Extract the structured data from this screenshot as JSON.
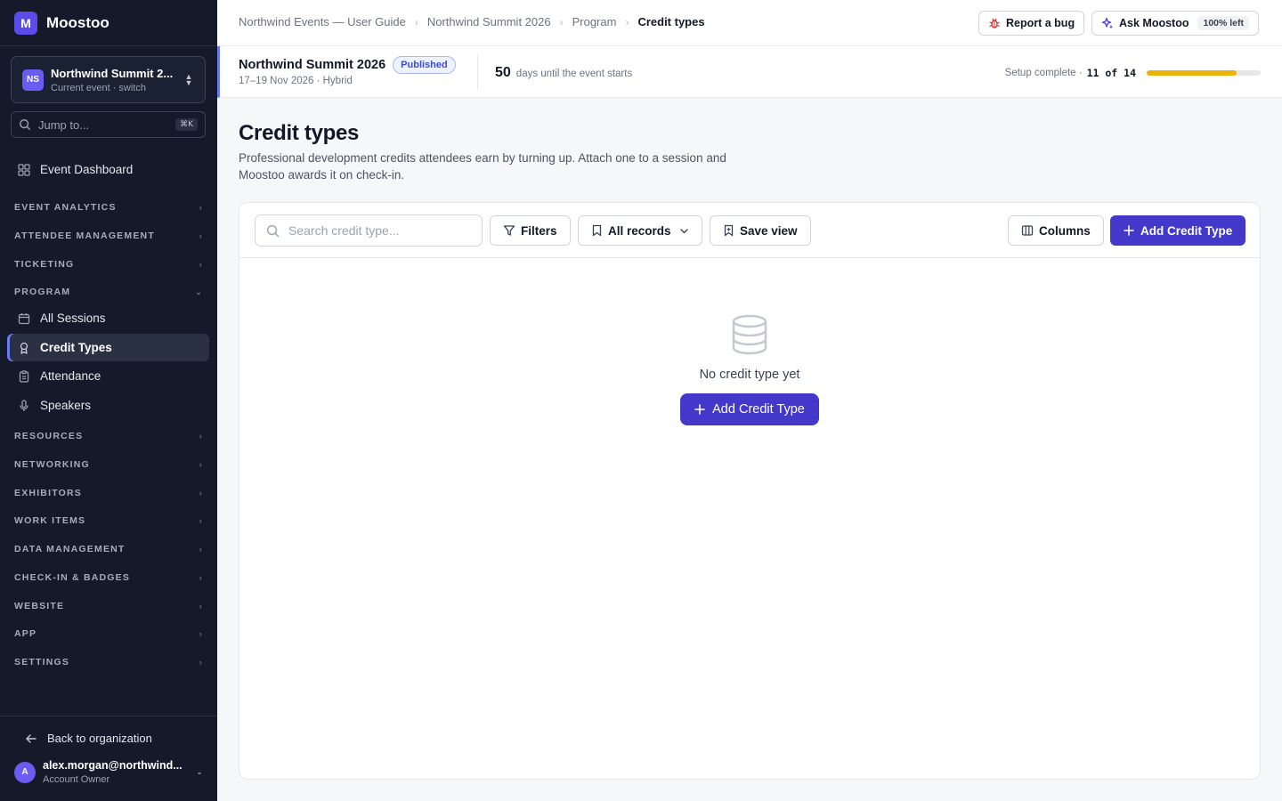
{
  "brand": {
    "logo_letter": "M",
    "name": "Moostoo"
  },
  "event_switcher": {
    "initials": "NS",
    "name": "Northwind Summit 2...",
    "subtitle": "Current event · switch"
  },
  "jump": {
    "placeholder": "Jump to...",
    "shortcut": "⌘K"
  },
  "nav": {
    "dashboard": "Event Dashboard",
    "sections": {
      "event_analytics": "EVENT ANALYTICS",
      "attendee_management": "ATTENDEE MANAGEMENT",
      "ticketing": "TICKETING",
      "program": "PROGRAM",
      "resources": "RESOURCES",
      "networking": "NETWORKING",
      "exhibitors": "EXHIBITORS",
      "work_items": "WORK ITEMS",
      "data_management": "DATA MANAGEMENT",
      "checkin_badges": "CHECK-IN & BADGES",
      "website": "WEBSITE",
      "app": "APP",
      "settings": "SETTINGS"
    },
    "program_items": {
      "all_sessions": "All Sessions",
      "credit_types": "Credit Types",
      "attendance": "Attendance",
      "speakers": "Speakers"
    }
  },
  "sidebar_footer": {
    "back": "Back to organization",
    "user_initial": "A",
    "user_email": "alex.morgan@northwind...",
    "user_role": "Account Owner"
  },
  "breadcrumb": {
    "c1": "Northwind Events — User Guide",
    "c2": "Northwind Summit 2026",
    "c3": "Program",
    "current": "Credit types"
  },
  "top_actions": {
    "report_bug": "Report a bug",
    "ask": "Ask Moostoo",
    "ask_pill": "100% left"
  },
  "event_header": {
    "name": "Northwind Summit 2026",
    "status": "Published",
    "dates": "17–19 Nov 2026 · Hybrid",
    "days": "50",
    "days_label": "days until the event starts",
    "setup_label": "Setup complete ·",
    "setup_value": "11 of 14",
    "setup_progress": 0.786
  },
  "page": {
    "title": "Credit types",
    "description": "Professional development credits attendees earn by turning up. Attach one to a session and Moostoo awards it on check-in."
  },
  "toolbar": {
    "search_placeholder": "Search credit type...",
    "filters": "Filters",
    "records": "All records",
    "save_view": "Save view",
    "columns": "Columns",
    "add": "Add Credit Type"
  },
  "empty_state": {
    "message": "No credit type yet",
    "button": "Add Credit Type"
  },
  "colors": {
    "sidebar_bg": "#141a2a",
    "primary": "#4338ca",
    "accent": "#6b7cf2",
    "progress": "#eab308"
  }
}
